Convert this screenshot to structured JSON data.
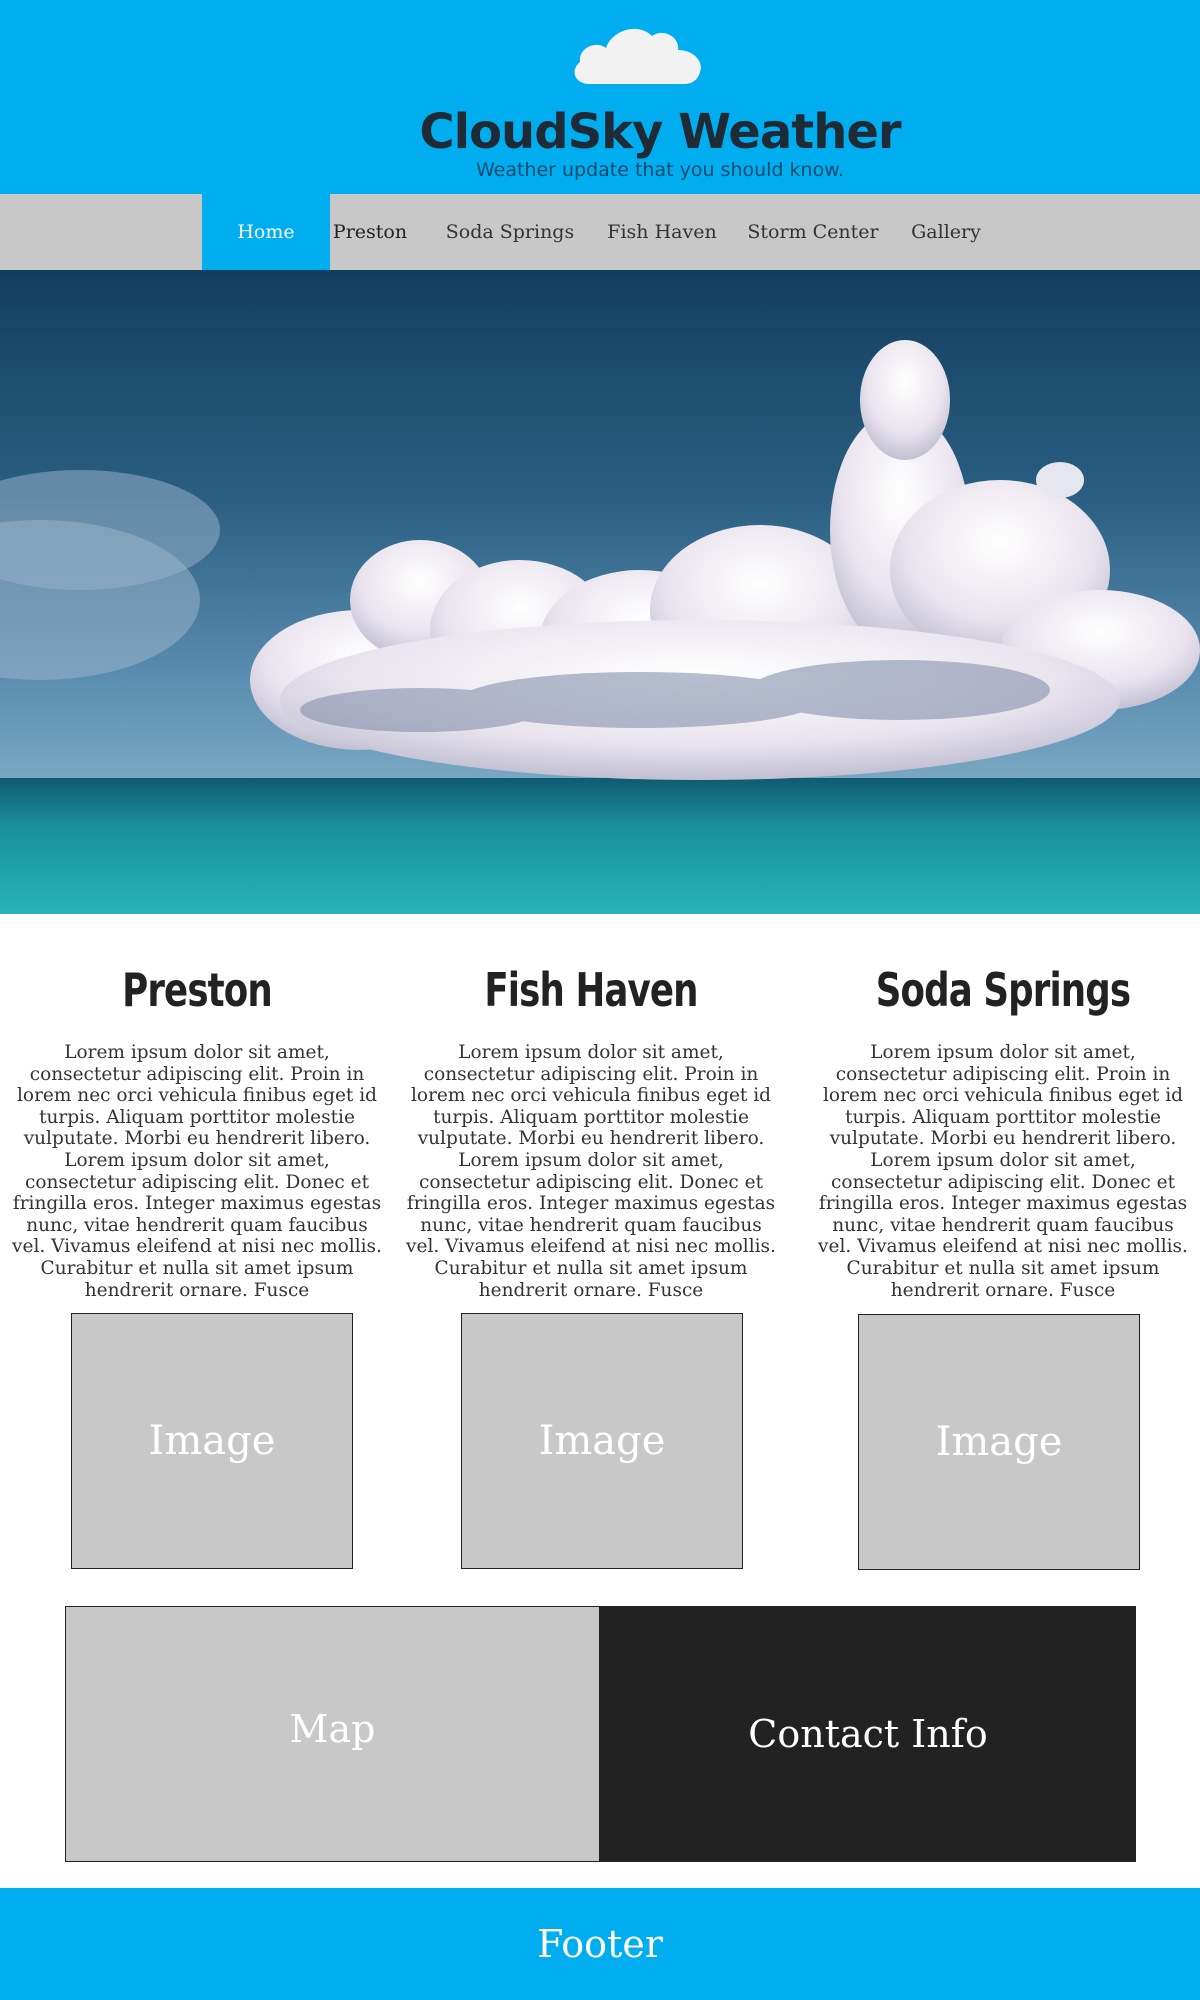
{
  "header": {
    "logo_icon": "cloud-icon",
    "title": "CloudSky Weather",
    "tagline": "Weather update that you should know.",
    "background": "#00aeef"
  },
  "nav": {
    "items": [
      {
        "label": "Home",
        "active": true
      },
      {
        "label": "Preston",
        "active": false
      },
      {
        "label": "Soda Springs",
        "active": false
      },
      {
        "label": "Fish Haven",
        "active": false
      },
      {
        "label": "Storm Center",
        "active": false
      },
      {
        "label": "Gallery",
        "active": false
      }
    ]
  },
  "hero": {
    "image": "ocean-clouds-photo"
  },
  "towns": [
    {
      "name": "Preston",
      "text": "Lorem ipsum dolor sit amet, consectetur adipiscing elit. Proin in lorem nec orci vehicula finibus eget id turpis. Aliquam porttitor molestie vulputate. Morbi eu hendrerit libero. Lorem ipsum dolor sit amet, consectetur adipiscing elit. Donec et fringilla eros. Integer maximus egestas nunc, vitae hendrerit quam faucibus vel. Vivamus eleifend at nisi nec mollis. Curabitur et nulla sit amet ipsum hendrerit ornare. Fusce",
      "image_label": "Image"
    },
    {
      "name": "Fish Haven",
      "text": "Lorem ipsum dolor sit amet, consectetur adipiscing elit. Proin in lorem nec orci vehicula finibus eget id turpis. Aliquam porttitor molestie vulputate. Morbi eu hendrerit libero. Lorem ipsum dolor sit amet, consectetur adipiscing elit. Donec et fringilla eros. Integer maximus egestas nunc, vitae hendrerit quam faucibus vel. Vivamus eleifend at nisi nec mollis. Curabitur et nulla sit amet ipsum hendrerit ornare. Fusce",
      "image_label": "Image"
    },
    {
      "name": "Soda Springs",
      "text": "Lorem ipsum dolor sit amet, consectetur adipiscing elit. Proin in lorem nec orci vehicula finibus eget id turpis. Aliquam porttitor molestie vulputate. Morbi eu hendrerit libero. Lorem ipsum dolor sit amet, consectetur adipiscing elit. Donec et fringilla eros. Integer maximus egestas nunc, vitae hendrerit quam faucibus vel. Vivamus eleifend at nisi nec mollis. Curabitur et nulla sit amet ipsum hendrerit ornare. Fusce",
      "image_label": "Image"
    }
  ],
  "map_label": "Map",
  "contact_label": "Contact Info",
  "footer_label": "Footer",
  "colors": {
    "accent": "#00aeef",
    "nav_bg": "#c8c8c8",
    "placeholder_bg": "#c8c8c8",
    "contact_bg": "#222222"
  }
}
